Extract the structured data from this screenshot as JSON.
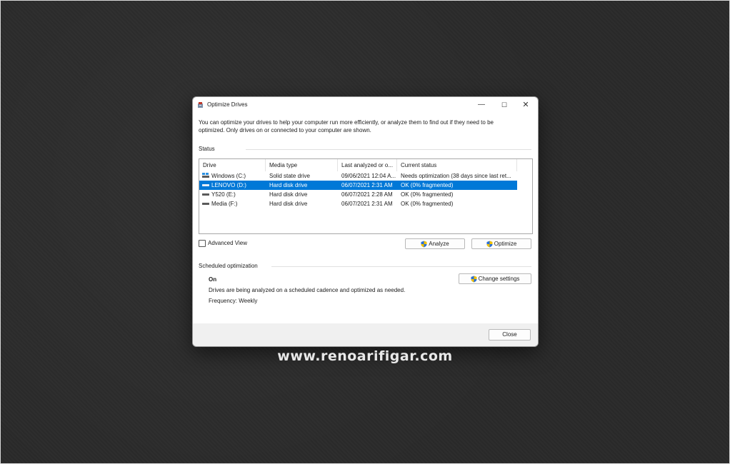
{
  "window": {
    "title": "Optimize Drives",
    "minimize_glyph": "—",
    "maximize_glyph": "☐",
    "close_glyph": "✕"
  },
  "description": "You can optimize your drives to help your computer run more efficiently, or analyze them to find out if they need to be optimized. Only drives on or connected to your computer are shown.",
  "status": {
    "label": "Status",
    "columns": [
      "Drive",
      "Media type",
      "Last analyzed or o...",
      "Current status"
    ],
    "drives": [
      {
        "drive": "Windows (C:)",
        "media_type": "Solid state drive",
        "last_analyzed": "09/06/2021 12:04 A...",
        "current_status": "Needs optimization (38 days since last ret...",
        "icon": "ssd-drive-icon",
        "selected": false
      },
      {
        "drive": "LENOVO (D:)",
        "media_type": "Hard disk drive",
        "last_analyzed": "06/07/2021 2:31 AM",
        "current_status": "OK (0% fragmented)",
        "icon": "hdd-drive-icon",
        "selected": true
      },
      {
        "drive": "Y520 (E:)",
        "media_type": "Hard disk drive",
        "last_analyzed": "06/07/2021 2:28 AM",
        "current_status": "OK (0% fragmented)",
        "icon": "hdd-drive-icon",
        "selected": false
      },
      {
        "drive": "Media (F:)",
        "media_type": "Hard disk drive",
        "last_analyzed": "06/07/2021 2:31 AM",
        "current_status": "OK (0% fragmented)",
        "icon": "hdd-drive-icon",
        "selected": false
      }
    ]
  },
  "advanced_view": {
    "label": "Advanced View",
    "checked": false
  },
  "buttons": {
    "analyze": "Analyze",
    "optimize": "Optimize",
    "change_settings": "Change settings",
    "close": "Close"
  },
  "scheduled": {
    "label": "Scheduled optimization",
    "state": "On",
    "description": "Drives are being analyzed on a scheduled cadence and optimized as needed.",
    "frequency": "Frequency: Weekly"
  },
  "watermark": "www.renoarifigar.com",
  "colors": {
    "selection": "#0078d7",
    "shield_blue": "#2b6fd6",
    "shield_yellow": "#f2c200"
  }
}
